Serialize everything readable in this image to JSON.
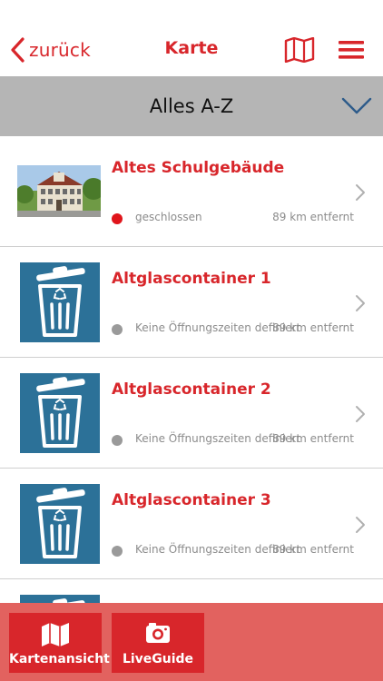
{
  "nav": {
    "back_label": "zurück",
    "title": "Karte",
    "icons": [
      "chevron-left-icon",
      "map-icon",
      "menu-icon"
    ]
  },
  "filter": {
    "label": "Alles A-Z",
    "icon": "chevron-down-icon"
  },
  "items": [
    {
      "title": "Altes Schulgebäude",
      "status": "geschlossen",
      "status_color": "#e0151b",
      "distance": "89 km entfernt",
      "image": "photo-school-building"
    },
    {
      "title": "Altglascontainer 1",
      "status": "Keine Öffnungszeiten definiert",
      "status_color": "#9a9a9a",
      "distance": "89 km entfernt",
      "image": "recycle-bin-icon"
    },
    {
      "title": "Altglascontainer 2",
      "status": "Keine Öffnungszeiten definiert",
      "status_color": "#9a9a9a",
      "distance": "89 km entfernt",
      "image": "recycle-bin-icon"
    },
    {
      "title": "Altglascontainer 3",
      "status": "Keine Öffnungszeiten definiert",
      "status_color": "#9a9a9a",
      "distance": "89 km entfernt",
      "image": "recycle-bin-icon"
    }
  ],
  "toolbar": {
    "buttons": [
      {
        "label": "Kartenansicht",
        "icon": "folded-map-icon"
      },
      {
        "label": "LiveGuide",
        "icon": "camera-icon"
      }
    ]
  },
  "colors": {
    "accent": "#d8262b",
    "filter_bar": "#b5b5b5",
    "bottom_bar": "#e2625f",
    "icon_tile": "#2c7198",
    "chevron_blue": "#2d5b8a"
  }
}
